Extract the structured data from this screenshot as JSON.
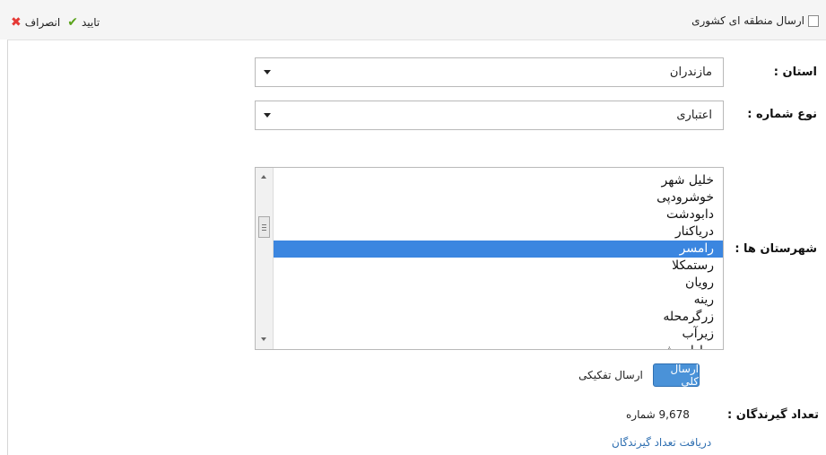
{
  "toolbar": {
    "cancel_label": "انصراف",
    "confirm_label": "تایید"
  },
  "send_regional": {
    "label": "ارسال منطقه ای کشوری",
    "checked": false
  },
  "form": {
    "province": {
      "label": "استان :",
      "value": "مازندران"
    },
    "number_type": {
      "label": "نوع شماره :",
      "value": "اعتباری"
    },
    "cities": {
      "label": "شهرستان ها :",
      "items": [
        "خلیل شهر",
        "خوشرودپی",
        "دابودشت",
        "درياكنار",
        "رامسر",
        "رستمکلا",
        "رویان",
        "رینه",
        "زرگرمحله",
        "زیرآب",
        "سادات شهر"
      ],
      "selected": "رامسر"
    },
    "send_mode": {
      "general_label": "ارسال کلی",
      "separate_label": "ارسال تفکیکی",
      "active": "general"
    },
    "recipients": {
      "label": "تعداد گیرندگان :",
      "value": "9,678 شماره",
      "fetch_link": "دریافت تعداد گیرندگان"
    }
  },
  "colors": {
    "selection": "#3b86e0",
    "primary_button": "#4a92d8",
    "link": "#2f6fb1"
  }
}
